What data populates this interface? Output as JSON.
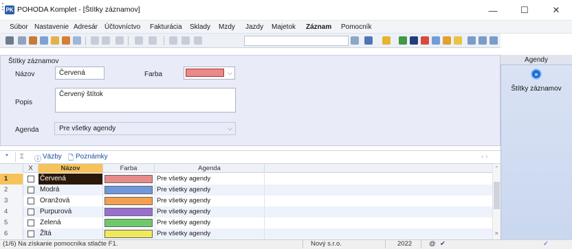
{
  "window": {
    "app_icon": "PK",
    "title": "POHODA Komplet - [Štítky záznamov]",
    "minimize": "—",
    "maximize": "☐",
    "close": "✕"
  },
  "menu": [
    "Súbor",
    "Nastavenie",
    "Adresár",
    "Účtovníctvo",
    "Fakturácia",
    "Sklady",
    "Mzdy",
    "Jazdy",
    "Majetok",
    "Záznam",
    "Pomocník"
  ],
  "form": {
    "group_title": "Štítky záznamov",
    "nazov_label": "Názov",
    "nazov_value": "Červená",
    "farba_label": "Farba",
    "farba_color": "#e88a8a",
    "popis_label": "Popis",
    "popis_value": "Červený štítok",
    "agenda_label": "Agenda",
    "agenda_value": "Pre všetky agendy"
  },
  "tabs": {
    "star": "*",
    "filter": "Σ",
    "vazby": "Väzby",
    "poznamky": "Poznámky"
  },
  "grid": {
    "columns": [
      "X",
      "Názov",
      "Farba",
      "Agenda"
    ],
    "rows": [
      {
        "num": "1",
        "name": "Červená",
        "color": "#e88a8a",
        "agenda": "Pre všetky agendy"
      },
      {
        "num": "2",
        "name": "Modrá",
        "color": "#6f98dc",
        "agenda": "Pre všetky agendy"
      },
      {
        "num": "3",
        "name": "Oranžová",
        "color": "#f4a04e",
        "agenda": "Pre všetky agendy"
      },
      {
        "num": "4",
        "name": "Purpurová",
        "color": "#9a6fd2",
        "agenda": "Pre všetky agendy"
      },
      {
        "num": "5",
        "name": "Zelená",
        "color": "#6ec96a",
        "agenda": "Pre všetky agendy"
      },
      {
        "num": "6",
        "name": "Žltá",
        "color": "#f0ea5a",
        "agenda": "Pre všetky agendy"
      }
    ]
  },
  "right_panel": {
    "header": "Agendy",
    "item_label": "Štítky záznamov"
  },
  "status": {
    "hint": "(1/6) Na získanie pomocníka stlačte F1.",
    "company": "Nový s.r.o.",
    "year": "2022",
    "at": "@"
  }
}
